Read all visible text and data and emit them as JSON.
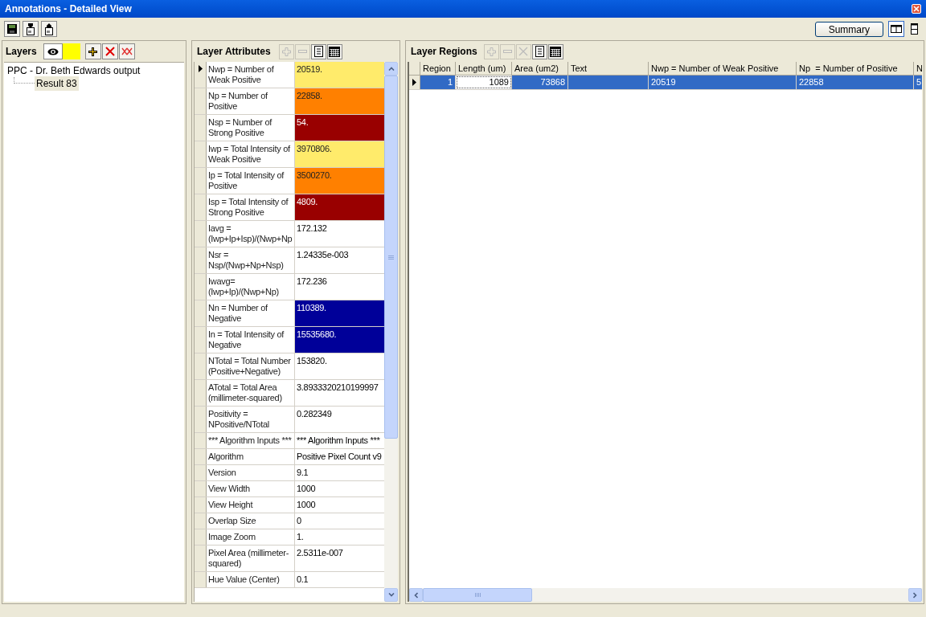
{
  "window": {
    "title": "Annotations - Detailed View"
  },
  "toolbar": {
    "summary_button": "Summary",
    "layout_toggles": [
      {
        "kind": "columns",
        "selected": true
      },
      {
        "kind": "rows",
        "selected": false
      }
    ]
  },
  "layers": {
    "title": "Layers",
    "eye_toggle": {
      "on": true
    },
    "layer_swatch": {
      "color": "#ffff00"
    },
    "tree": [
      {
        "label": "PPC - Dr. Beth Edwards output",
        "selected": false,
        "children": [
          {
            "label": "Result 83",
            "selected": true
          }
        ]
      }
    ]
  },
  "attributes": {
    "title": "Layer Attributes",
    "rows": [
      {
        "name": "Nwp = Number of Weak Positive",
        "value": "20519.",
        "color": "#ffeb6b",
        "current": true
      },
      {
        "name": "Np  = Number of Positive",
        "value": "22858.",
        "color": "#ff8000",
        "current": false
      },
      {
        "name": "Nsp = Number of Strong Positive",
        "value": "54.",
        "color": "#990000",
        "current": false
      },
      {
        "name": "Iwp = Total Intensity of Weak Positive",
        "value": "3970806.",
        "color": "#ffeb6b",
        "current": false
      },
      {
        "name": "Ip  = Total Intensity of Positive",
        "value": "3500270.",
        "color": "#ff8000",
        "current": false
      },
      {
        "name": "Isp = Total Intensity of Strong Positive",
        "value": "4809.",
        "color": "#990000",
        "current": false
      },
      {
        "name": "Iavg = (Iwp+Ip+Isp)/(Nwp+Np",
        "value": "172.132",
        "current": false
      },
      {
        "name": "Nsr  = Nsp/(Nwp+Np+Nsp)",
        "value": "1.24335e-003",
        "current": false
      },
      {
        "name": "Iwavg= (Iwp+Ip)/(Nwp+Np)",
        "value": "172.236",
        "current": false
      },
      {
        "name": "Nn = Number of Negative",
        "value": "110389.",
        "color": "#000099",
        "current": false
      },
      {
        "name": "In = Total Intensity of Negative",
        "value": "15535680.",
        "color": "#000099",
        "current": false
      },
      {
        "name": "NTotal = Total Number (Positive+Negative)",
        "value": "153820.",
        "current": false
      },
      {
        "name": "ATotal = Total Area (millimeter-squared)",
        "value": "3.8933320210199997",
        "current": false
      },
      {
        "name": "Positivity = NPositive/NTotal",
        "value": "0.282349",
        "current": false
      },
      {
        "name": "*** Algorithm Inputs ***",
        "value": "*** Algorithm Inputs ***",
        "current": false
      },
      {
        "name": "Algorithm",
        "value": "Positive Pixel Count v9",
        "current": false
      },
      {
        "name": "Version",
        "value": "9.1",
        "current": false
      },
      {
        "name": "View Width",
        "value": "1000",
        "current": false
      },
      {
        "name": "View Height",
        "value": "1000",
        "current": false
      },
      {
        "name": "Overlap Size",
        "value": "0",
        "current": false
      },
      {
        "name": "Image Zoom",
        "value": "1.",
        "current": false
      },
      {
        "name": "Pixel Area (millimeter-squared)",
        "value": "2.5311e-007",
        "current": false
      },
      {
        "name": "Hue Value (Center)",
        "value": "0.1",
        "current": false
      }
    ]
  },
  "regions": {
    "title": "Layer Regions",
    "columns": [
      "Region",
      "Length (um)",
      "Area (um2)",
      "Text",
      "Nwp = Number of Weak Positive",
      "Np  = Number of Positive",
      "N"
    ],
    "rows": [
      {
        "selected": true,
        "cells": [
          {
            "text": "1",
            "focused": false
          },
          {
            "text": "1089",
            "focused": true
          },
          {
            "text": "73868",
            "focused": false
          },
          {
            "focused": false
          },
          {
            "text": "20519",
            "focused": false
          },
          {
            "text": "22858",
            "focused": false
          },
          {
            "text": "5",
            "focused": false
          }
        ]
      }
    ]
  }
}
